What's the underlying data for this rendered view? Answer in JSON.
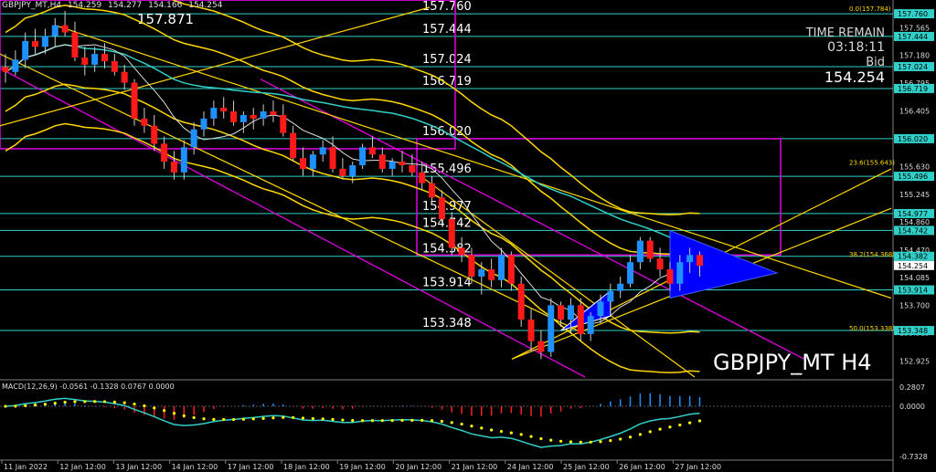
{
  "header": {
    "symbol_tf": "GBPJPY_MT,H4",
    "ohlc": [
      "154.259",
      "154.277",
      "154.166",
      "154.254"
    ]
  },
  "info": {
    "time_remain_label": "TIME REMAIN",
    "time_remain": "03:18:11",
    "bid_label": "Bid",
    "bid": "154.254"
  },
  "watermark": "GBPJPY_MT H4",
  "macd_label": "MACD(12,26,9) -0.0561 -0.1328 0.0767 0.0000",
  "colors": {
    "bull": "#1e90ff",
    "bear": "#ff1a1a",
    "level": "#30d0c8",
    "box": "#e000e0",
    "channel": "#ffd700",
    "triangle": "#0000ff",
    "macd_signal": "#ffff00"
  },
  "chart_data": {
    "type": "candlestick",
    "ylim": [
      152.7,
      157.85
    ],
    "price_ticks": [
      "157.760",
      "157.565",
      "157.180",
      "156.795",
      "156.405",
      "156.020",
      "155.630",
      "155.245",
      "154.860",
      "154.470",
      "154.085",
      "153.700",
      "153.315",
      "152.925"
    ],
    "x_ticks": [
      "11 Jan 2022",
      "12 Jan 12:00",
      "13 Jan 12:00",
      "14 Jan 12:00",
      "17 Jan 12:00",
      "18 Jan 12:00",
      "19 Jan 12:00",
      "20 Jan 12:00",
      "21 Jan 12:00",
      "24 Jan 12:00",
      "25 Jan 12:00",
      "26 Jan 12:00",
      "27 Jan 12:00"
    ],
    "levels": [
      {
        "label": "157.760",
        "value": 157.76
      },
      {
        "label": "157.444",
        "value": 157.444
      },
      {
        "label": "157.024",
        "value": 157.024
      },
      {
        "label": "156.719",
        "value": 156.719
      },
      {
        "label": "156.020",
        "value": 156.02
      },
      {
        "label": "155.496",
        "value": 155.496
      },
      {
        "label": "154.977",
        "value": 154.977
      },
      {
        "label": "154.742",
        "value": 154.742
      },
      {
        "label": "154.382",
        "value": 154.382
      },
      {
        "label": "153.914",
        "value": 153.914
      },
      {
        "label": "153.348",
        "value": 153.348
      }
    ],
    "fib_labels": [
      {
        "label": "0.0(157.784)",
        "value": 157.784
      },
      {
        "label": "23.6(155.643)",
        "value": 155.643
      },
      {
        "label": "38.2(154.368)",
        "value": 154.368
      },
      {
        "label": "50.0(153.338)",
        "value": 153.338
      }
    ],
    "top_label": "157.871",
    "price_tags": [
      "157.760",
      "157.444",
      "157.024",
      "156.719",
      "156.020",
      "155.496",
      "154.977",
      "154.742",
      "154.382",
      "154.254",
      "153.914",
      "153.348"
    ],
    "candles": [
      [
        157.02,
        157.2,
        156.8,
        156.95
      ],
      [
        156.95,
        157.25,
        156.9,
        157.12
      ],
      [
        157.12,
        157.5,
        157.0,
        157.38
      ],
      [
        157.38,
        157.55,
        157.2,
        157.3
      ],
      [
        157.3,
        157.55,
        157.2,
        157.45
      ],
      [
        157.45,
        157.7,
        157.3,
        157.6
      ],
      [
        157.6,
        157.8,
        157.45,
        157.5
      ],
      [
        157.5,
        157.65,
        157.1,
        157.15
      ],
      [
        157.15,
        157.3,
        156.9,
        157.05
      ],
      [
        157.05,
        157.3,
        156.95,
        157.2
      ],
      [
        157.2,
        157.35,
        157.0,
        157.1
      ],
      [
        157.1,
        157.2,
        156.9,
        156.95
      ],
      [
        156.95,
        157.05,
        156.7,
        156.8
      ],
      [
        156.8,
        156.85,
        156.2,
        156.3
      ],
      [
        156.3,
        156.45,
        156.1,
        156.2
      ],
      [
        156.2,
        156.35,
        155.85,
        155.95
      ],
      [
        155.95,
        156.05,
        155.6,
        155.7
      ],
      [
        155.7,
        155.85,
        155.45,
        155.55
      ],
      [
        155.55,
        156.0,
        155.45,
        155.9
      ],
      [
        155.9,
        156.25,
        155.8,
        156.15
      ],
      [
        156.15,
        156.4,
        156.05,
        156.3
      ],
      [
        156.3,
        156.55,
        156.2,
        156.45
      ],
      [
        156.45,
        156.6,
        156.3,
        156.4
      ],
      [
        156.4,
        156.55,
        156.2,
        156.25
      ],
      [
        156.25,
        156.4,
        156.1,
        156.35
      ],
      [
        156.35,
        156.45,
        156.15,
        156.3
      ],
      [
        156.3,
        156.5,
        156.2,
        156.4
      ],
      [
        156.4,
        156.55,
        156.25,
        156.35
      ],
      [
        156.35,
        156.5,
        156.05,
        156.1
      ],
      [
        156.1,
        156.2,
        155.7,
        155.75
      ],
      [
        155.75,
        155.9,
        155.5,
        155.6
      ],
      [
        155.6,
        155.85,
        155.5,
        155.8
      ],
      [
        155.8,
        156.0,
        155.7,
        155.9
      ],
      [
        155.9,
        156.05,
        155.55,
        155.6
      ],
      [
        155.6,
        155.75,
        155.45,
        155.5
      ],
      [
        155.5,
        155.7,
        155.4,
        155.65
      ],
      [
        155.65,
        155.95,
        155.6,
        155.9
      ],
      [
        155.9,
        156.05,
        155.75,
        155.8
      ],
      [
        155.8,
        155.9,
        155.55,
        155.6
      ],
      [
        155.6,
        155.75,
        155.5,
        155.7
      ],
      [
        155.7,
        155.85,
        155.55,
        155.65
      ],
      [
        155.65,
        155.8,
        155.5,
        155.55
      ],
      [
        155.55,
        155.7,
        155.3,
        155.4
      ],
      [
        155.4,
        155.5,
        155.15,
        155.2
      ],
      [
        155.2,
        155.3,
        154.85,
        154.9
      ],
      [
        154.9,
        155.0,
        154.4,
        154.5
      ],
      [
        154.5,
        154.65,
        154.3,
        154.4
      ],
      [
        154.4,
        154.5,
        154.0,
        154.1
      ],
      [
        154.1,
        154.3,
        153.85,
        154.2
      ],
      [
        154.2,
        154.35,
        153.95,
        154.05
      ],
      [
        154.05,
        154.5,
        153.95,
        154.4
      ],
      [
        154.4,
        154.45,
        153.9,
        154.0
      ],
      [
        154.0,
        154.1,
        153.4,
        153.5
      ],
      [
        153.5,
        153.65,
        153.05,
        153.2
      ],
      [
        153.2,
        153.35,
        152.95,
        153.05
      ],
      [
        153.05,
        153.8,
        152.98,
        153.7
      ],
      [
        153.7,
        153.75,
        153.4,
        153.5
      ],
      [
        153.5,
        153.8,
        153.3,
        153.7
      ],
      [
        153.7,
        153.8,
        153.2,
        153.3
      ],
      [
        153.3,
        153.6,
        153.2,
        153.55
      ],
      [
        153.55,
        153.85,
        153.45,
        153.75
      ],
      [
        153.75,
        154.0,
        153.65,
        153.9
      ],
      [
        153.9,
        154.1,
        153.8,
        154.0
      ],
      [
        154.0,
        154.4,
        153.95,
        154.3
      ],
      [
        154.3,
        154.65,
        154.2,
        154.6
      ],
      [
        154.6,
        154.65,
        154.3,
        154.35
      ],
      [
        154.35,
        154.5,
        154.1,
        154.2
      ],
      [
        154.2,
        154.3,
        153.9,
        154.0
      ],
      [
        154.0,
        154.4,
        153.9,
        154.3
      ],
      [
        154.3,
        154.5,
        154.15,
        154.4
      ],
      [
        154.4,
        154.45,
        154.1,
        154.25
      ]
    ],
    "macd_ylim": [
      -0.7328,
      0.2807
    ],
    "macd_ticks": [
      "0.2807",
      "0.0000",
      "-0.7328"
    ]
  }
}
